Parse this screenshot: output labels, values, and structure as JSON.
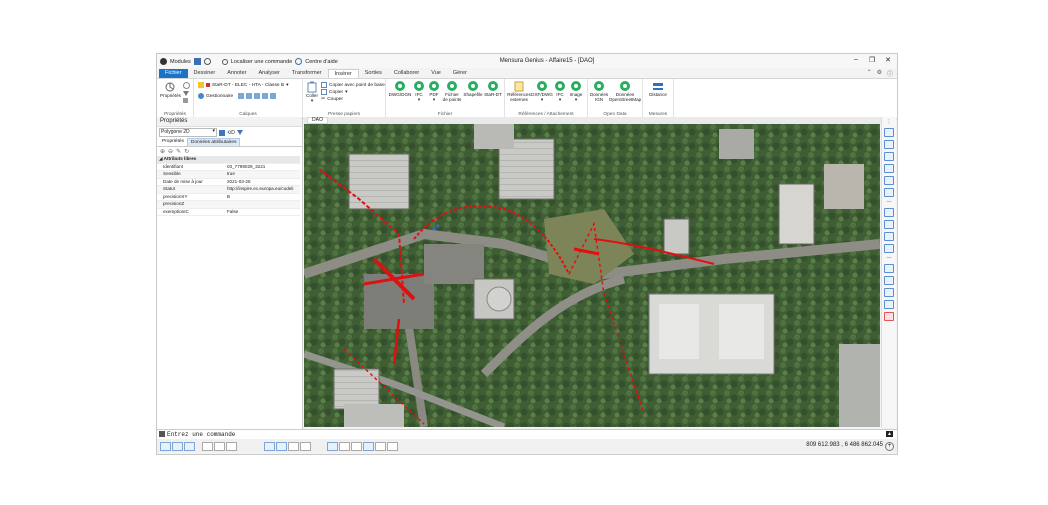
{
  "window": {
    "title": "Mensura Genius - Affaire15 - [DAO]",
    "controls": [
      "–",
      "❐",
      "✕"
    ]
  },
  "quick_access": {
    "modules": "Modules",
    "locate": "Localiser une commande",
    "help": "Centre d'aide"
  },
  "ribbon_tabs": [
    "Fichier",
    "Dessiner",
    "Annoter",
    "Analyser",
    "Transformer",
    "Insérer",
    "Sorties",
    "Collaborer",
    "Vue",
    "Gérer"
  ],
  "active_tab": "Insérer",
  "ribbon": {
    "props_group": {
      "button": "Propriétés",
      "label": "Propriétés"
    },
    "layers_group": {
      "layer": "StaR-DT - ELEC - HTA - Classe B",
      "manager": "Gestionnaire",
      "label": "Calques"
    },
    "clipboard_group": {
      "paste": "Coller",
      "copy_base": "Copier avec point de base",
      "copy": "Copier",
      "cut": "Couper",
      "label": "Presse papiers"
    },
    "file_group": {
      "buttons": [
        "DWG/DGN",
        "IFC",
        "PDF",
        "Fichier de points",
        "Shapefile",
        "StaR-DT"
      ],
      "label": "Fichier"
    },
    "refs_group": {
      "buttons": [
        "Références externes",
        "DXF/DWG",
        "IFC",
        "Image"
      ],
      "label": "Références / Attachement"
    },
    "opendata_group": {
      "buttons": [
        "Données IGN",
        "Données OpenStreetMap"
      ],
      "label": "Open Data"
    },
    "measures_group": {
      "buttons": [
        "Distance"
      ],
      "label": "Mesures"
    }
  },
  "panel": {
    "title": "Propriétés",
    "selection": "Polygone 2D",
    "tabs": [
      "Propriétés",
      "Données attributaires"
    ],
    "active_tab": "Données attributaires",
    "section": "Attributs libres",
    "rows": [
      {
        "key": "Identifiant",
        "value": "03_7799029_3221"
      },
      {
        "key": "Sensible",
        "value": "true"
      },
      {
        "key": "Date de mise à jour",
        "value": "2021-03-25"
      },
      {
        "key": "Statut",
        "value": "http://inspire.ec.europa.eu/codeli"
      },
      {
        "key": "precisionXY",
        "value": "B"
      },
      {
        "key": "precisionZ",
        "value": ""
      },
      {
        "key": "exemptionIC",
        "value": "False"
      }
    ]
  },
  "document_tab": "DAO",
  "command_line": {
    "placeholder": "Entrez une commande"
  },
  "status": {
    "coordinates": "809 612.983 , 6 486 862.045"
  },
  "colors": {
    "accent": "#1a73c9",
    "network_line": "#e01010",
    "ribbon_icon": "#27ae60"
  }
}
